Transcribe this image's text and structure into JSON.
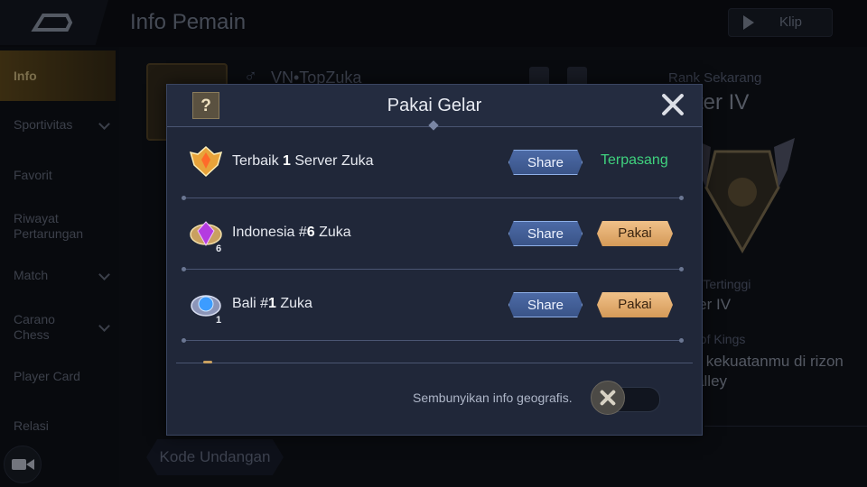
{
  "header": {
    "title": "Info Pemain",
    "clip_label": "Klip"
  },
  "sidebar": {
    "items": [
      {
        "label": "Info",
        "active": true
      },
      {
        "label": "Sportivitas",
        "expandable": true
      },
      {
        "label": "Favorit"
      },
      {
        "label": "Riwayat Pertarungan"
      },
      {
        "label": "Match",
        "expandable": true
      },
      {
        "label": "Carano Chess",
        "expandable": true
      },
      {
        "label": "Player Card"
      },
      {
        "label": "Relasi"
      }
    ]
  },
  "profile": {
    "name": "VN•TopZuka",
    "rank_label": "Rank Sekarang",
    "rank": "ster IV",
    "highest_label": "nk Tertinggi",
    "highest": "ster IV",
    "hall_label": "al of Kings",
    "hall_desc": "kti kekuatanmu di rizon Valley",
    "invite_code_label": "Kode Undangan"
  },
  "dialog": {
    "title": "Pakai Gelar",
    "help_label": "?",
    "titles": [
      {
        "pre": "Terbaik ",
        "num": "1",
        "post": " Server Zuka",
        "badge_num": "",
        "share": "Share",
        "status": "Terpasang",
        "equipped": true
      },
      {
        "pre": "Indonesia #",
        "num": "6",
        "post": " Zuka",
        "badge_num": "6",
        "share": "Share",
        "status": "Pakai",
        "equipped": false
      },
      {
        "pre": "Bali #",
        "num": "1",
        "post": " Zuka",
        "badge_num": "1",
        "share": "Share",
        "status": "Pakai",
        "equipped": false
      }
    ],
    "geo_toggle_label": "Sembunyikan info geografis.",
    "geo_toggle_on": false
  },
  "colors": {
    "accent_gold": "#d59a58",
    "equipped_green": "#3fd27e",
    "share_blue": "#3a5488"
  }
}
